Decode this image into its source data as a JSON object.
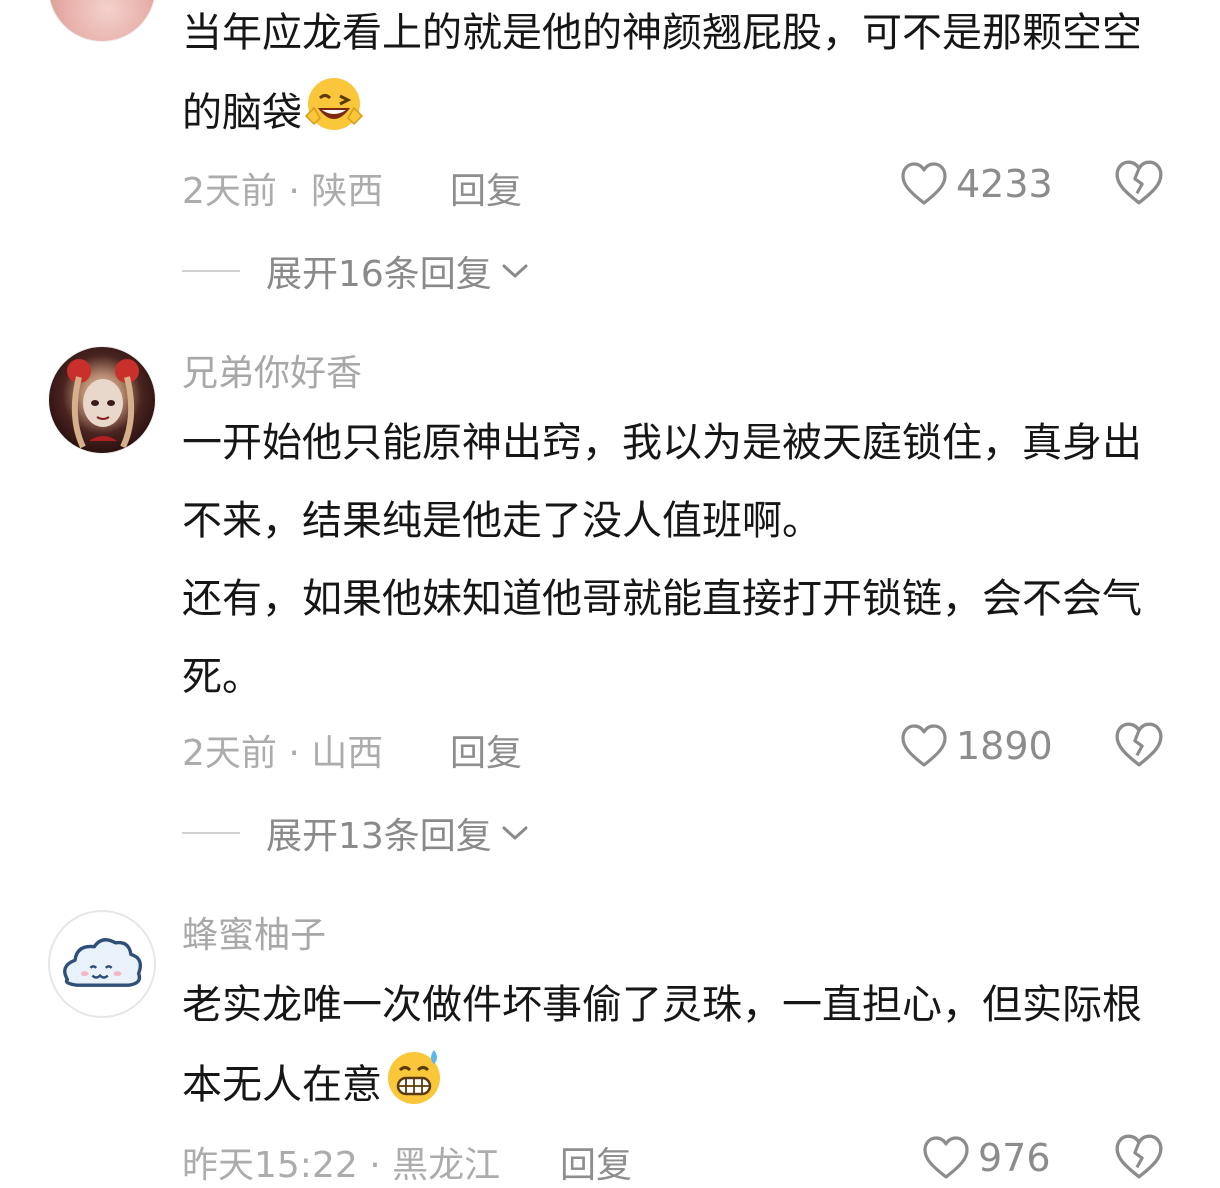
{
  "comments": [
    {
      "username": "",
      "paragraphs": [
        "当年应龙看上的就是他的神颜翘屁股，可不是那颗空空的脑袋"
      ],
      "emoji": "grinning-wink-emoji",
      "time_location": "2天前 · 陕西",
      "reply_label": "回复",
      "likes": "4233",
      "expand_label": "展开16条回复"
    },
    {
      "username": "兄弟你好香",
      "paragraphs": [
        "一开始他只能原神出窍，我以为是被天庭锁住，真身出不来，结果纯是他走了没人值班啊。",
        "还有，如果他妹知道他哥就能直接打开锁链，会不会气死。"
      ],
      "time_location": "2天前 · 山西",
      "reply_label": "回复",
      "likes": "1890",
      "expand_label": "展开13条回复"
    },
    {
      "username": "蜂蜜柚子",
      "paragraphs": [
        "老实龙唯一次做件坏事偷了灵珠，一直担心，但实际根本无人在意"
      ],
      "emoji": "sweat-grin-emoji",
      "time_location": "昨天15:22 · 黑龙江",
      "reply_label": "回复",
      "likes": "976"
    }
  ],
  "colors": {
    "text": "#161616",
    "muted": "#a8a8a8",
    "icon": "#8c8c8c"
  }
}
